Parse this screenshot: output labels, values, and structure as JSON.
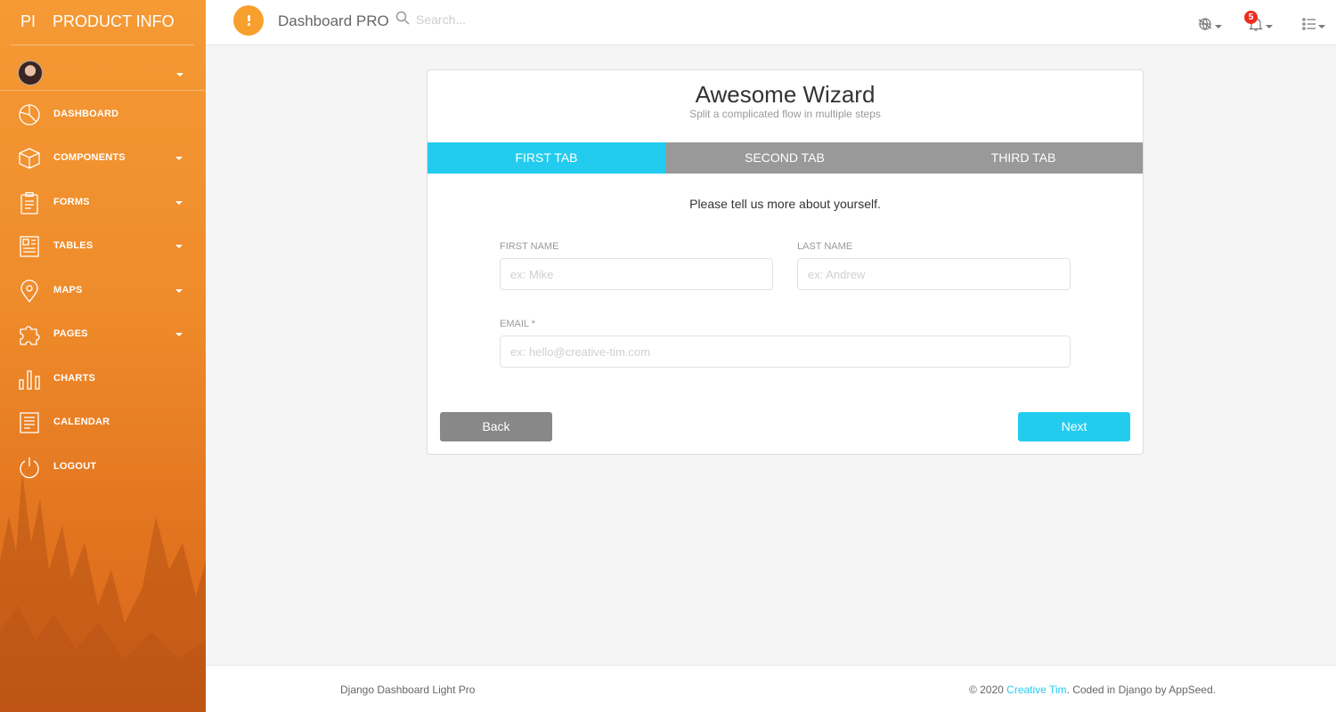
{
  "sidebar": {
    "brand_mini": "PI",
    "brand_full": "PRODUCT INFO",
    "items": [
      {
        "label": "DASHBOARD",
        "icon": "pie-chart-icon"
      },
      {
        "label": "COMPONENTS",
        "icon": "box-icon"
      },
      {
        "label": "FORMS",
        "icon": "clipboard-icon"
      },
      {
        "label": "TABLES",
        "icon": "table-icon"
      },
      {
        "label": "MAPS",
        "icon": "map-pin-icon"
      },
      {
        "label": "PAGES",
        "icon": "puzzle-icon"
      },
      {
        "label": "CHARTS",
        "icon": "bar-chart-icon"
      },
      {
        "label": "CALENDAR",
        "icon": "notepad-icon"
      },
      {
        "label": "LOGOUT",
        "icon": "power-icon"
      }
    ]
  },
  "topbar": {
    "title": "Dashboard PRO",
    "search_placeholder": "Search...",
    "notifications_count": "5"
  },
  "wizard": {
    "title": "Awesome Wizard",
    "subtitle": "Split a complicated flow in multiple steps",
    "tabs": [
      "FIRST TAB",
      "SECOND TAB",
      "THIRD TAB"
    ],
    "active_tab": "FIRST TAB",
    "info_text": "Please tell us more about yourself.",
    "fields": {
      "first_name": {
        "label": "FIRST NAME",
        "placeholder": "ex: Mike",
        "value": ""
      },
      "last_name": {
        "label": "LAST NAME",
        "placeholder": "ex: Andrew",
        "value": ""
      },
      "email": {
        "label": "EMAIL *",
        "placeholder": "ex: hello@creative-tim.com",
        "value": ""
      }
    },
    "back_label": "Back",
    "next_label": "Next"
  },
  "footer": {
    "left": "Django Dashboard Light Pro",
    "right_prefix": "© 2020",
    "right_link": "Creative Tim",
    "right_suffix": ". Coded in Django by AppSeed."
  },
  "colors": {
    "accent": "#23ccef",
    "sidebar_top": "#f59a35",
    "sidebar_bottom": "#d9661b",
    "badge": "#ee2d20",
    "tab_inactive": "#999999"
  }
}
